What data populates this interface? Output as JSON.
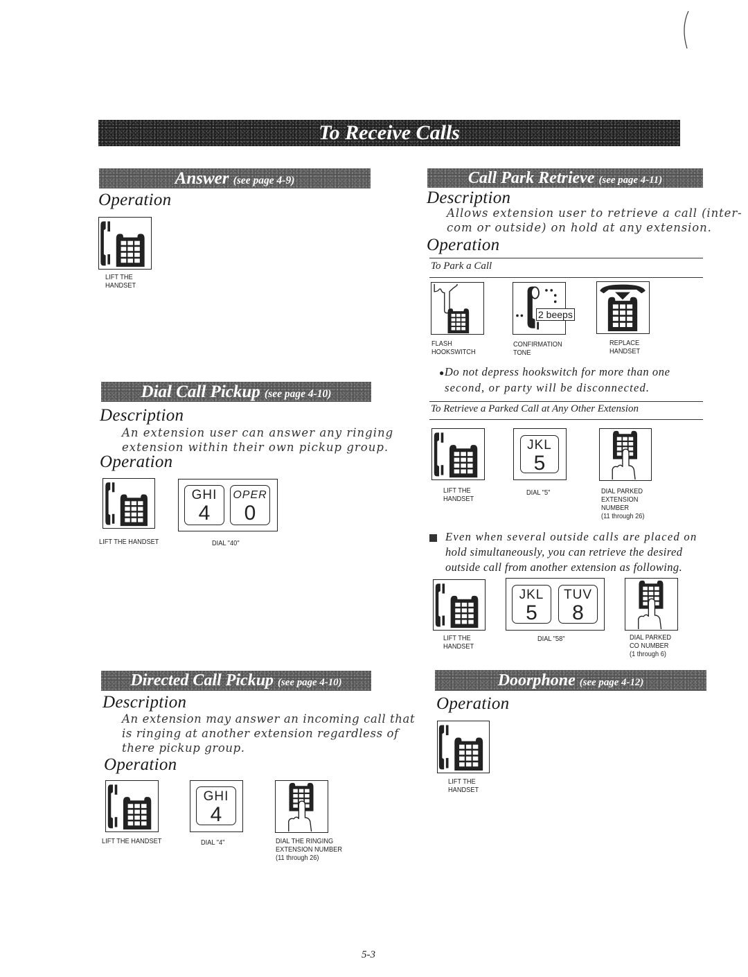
{
  "page": {
    "title": "To Receive Calls",
    "page_number": "5-3"
  },
  "sections": {
    "answer": {
      "title": "Answer",
      "see": "(see page 4-9)",
      "operation_heading": "Operation",
      "steps": [
        {
          "icon": "lift-handset-icon",
          "caption_line1": "LIFT THE",
          "caption_line2": "HANDSET"
        }
      ]
    },
    "dial_call_pickup": {
      "title": "Dial Call Pickup",
      "see": "(see page 4-10)",
      "description_heading": "Description",
      "description": [
        "An extension user can answer any ringing",
        "extension within their own pickup group."
      ],
      "operation_heading": "Operation",
      "steps": [
        {
          "icon": "lift-handset-icon",
          "caption": "LIFT THE HANDSET"
        },
        {
          "icon": "keypad-keys-icon",
          "keys": [
            {
              "letters": "GHI",
              "digit": "4"
            },
            {
              "letters": "OPER",
              "digit": "0"
            }
          ],
          "caption": "DIAL \"40\""
        }
      ]
    },
    "directed_call_pickup": {
      "title": "Directed Call Pickup",
      "see": "(see page 4-10)",
      "description_heading": "Description",
      "description": [
        "An extension may answer an incoming call that",
        "is ringing at another extension regardless of",
        "there pickup group."
      ],
      "operation_heading": "Operation",
      "steps": [
        {
          "icon": "lift-handset-icon",
          "caption": "LIFT THE HANDSET"
        },
        {
          "icon": "keypad-key-icon",
          "keys": [
            {
              "letters": "GHI",
              "digit": "4"
            }
          ],
          "caption": "DIAL \"4\""
        },
        {
          "icon": "dial-finger-icon",
          "caption_line1": "DIAL THE  RINGING",
          "caption_line2": "EXTENSION NUMBER",
          "caption_line3": "(11 through 26)"
        }
      ]
    },
    "call_park_retrieve": {
      "title": "Call Park Retrieve",
      "see": "(see page 4-11)",
      "description_heading": "Description",
      "description": [
        "Allows extension user to retrieve a call (inter-",
        "com or outside) on hold at any extension."
      ],
      "operation_heading": "Operation",
      "park": {
        "subheading": "To Park a Call",
        "steps": [
          {
            "icon": "flash-hookswitch-icon",
            "caption_line1": "FLASH",
            "caption_line2": "HOOKSWITCH"
          },
          {
            "icon": "confirmation-tone-icon",
            "beeps_label": "2 beeps",
            "caption_line1": "CONFIRMATION",
            "caption_line2": "TONE"
          },
          {
            "icon": "replace-handset-icon",
            "caption_line1": "REPLACE",
            "caption_line2": "HANDSET"
          }
        ],
        "note": [
          "Do not depress hookswitch for more than one",
          "second, or party will be disconnected."
        ]
      },
      "retrieve": {
        "subheading": "To Retrieve a Parked Call at Any Other Extension",
        "steps": [
          {
            "icon": "lift-handset-icon",
            "caption_line1": "LIFT THE",
            "caption_line2": "HANDSET"
          },
          {
            "icon": "keypad-key-icon",
            "keys": [
              {
                "letters": "JKL",
                "digit": "5"
              }
            ],
            "caption": "DIAL \"5\""
          },
          {
            "icon": "dial-finger-icon",
            "caption_line1": "DIAL PARKED",
            "caption_line2": "EXTENSION",
            "caption_line3": "NUMBER",
            "caption_line4": "(11 through 26)"
          }
        ]
      },
      "outside": {
        "note": [
          "Even when several outside calls are placed on",
          "hold simultaneously, you can retrieve the desired",
          "outside call from another extension as following."
        ],
        "steps": [
          {
            "icon": "lift-handset-icon",
            "caption_line1": "LIFT THE",
            "caption_line2": "HANDSET"
          },
          {
            "icon": "keypad-keys-icon",
            "keys": [
              {
                "letters": "JKL",
                "digit": "5"
              },
              {
                "letters": "TUV",
                "digit": "8"
              }
            ],
            "caption": "DIAL \"58\""
          },
          {
            "icon": "dial-finger-icon",
            "caption_line1": "DIAL PARKED",
            "caption_line2": "CO NUMBER",
            "caption_line3": "(1 through 6)"
          }
        ]
      }
    },
    "doorphone": {
      "title": "Doorphone",
      "see": "(see page 4-12)",
      "operation_heading": "Operation",
      "steps": [
        {
          "icon": "lift-handset-icon",
          "caption_line1": "LIFT THE",
          "caption_line2": "HANDSET"
        }
      ]
    }
  }
}
